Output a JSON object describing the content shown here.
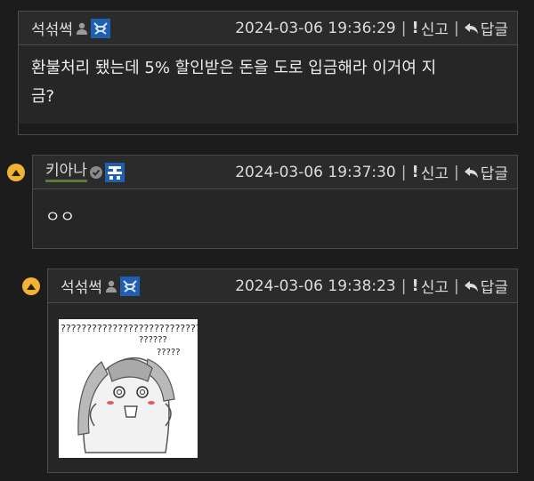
{
  "comments": [
    {
      "nick": "석섞썩",
      "timestamp": "2024-03-06 19:36:29",
      "report_label": "신고",
      "reply_label": "답글",
      "body_line1": "환불처리 됐는데 5% 할인받은 돈을 도로 입금해라 이거여 지",
      "body_line2": "금?"
    },
    {
      "nick": "키아나",
      "timestamp": "2024-03-06 19:37:30",
      "report_label": "신고",
      "reply_label": "답글",
      "body": "ㅇㅇ"
    },
    {
      "nick": "석섞썩",
      "timestamp": "2024-03-06 19:38:23",
      "report_label": "신고",
      "reply_label": "답글",
      "sticker_text": "???????????????????????????"
    }
  ],
  "colors": {
    "accent_collapse": "#f2b233",
    "badge_blue": "#1f5fb0",
    "nick_underline": "#5d7a3b"
  }
}
